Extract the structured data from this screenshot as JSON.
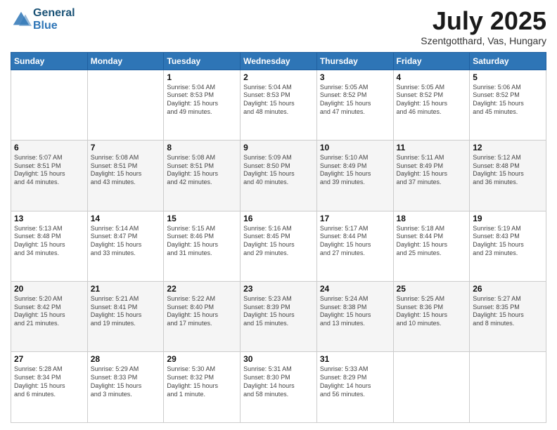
{
  "header": {
    "logo_line1": "General",
    "logo_line2": "Blue",
    "month": "July 2025",
    "location": "Szentgotthard, Vas, Hungary"
  },
  "weekdays": [
    "Sunday",
    "Monday",
    "Tuesday",
    "Wednesday",
    "Thursday",
    "Friday",
    "Saturday"
  ],
  "weeks": [
    [
      {
        "day": "",
        "text": ""
      },
      {
        "day": "",
        "text": ""
      },
      {
        "day": "1",
        "text": "Sunrise: 5:04 AM\nSunset: 8:53 PM\nDaylight: 15 hours\nand 49 minutes."
      },
      {
        "day": "2",
        "text": "Sunrise: 5:04 AM\nSunset: 8:53 PM\nDaylight: 15 hours\nand 48 minutes."
      },
      {
        "day": "3",
        "text": "Sunrise: 5:05 AM\nSunset: 8:52 PM\nDaylight: 15 hours\nand 47 minutes."
      },
      {
        "day": "4",
        "text": "Sunrise: 5:05 AM\nSunset: 8:52 PM\nDaylight: 15 hours\nand 46 minutes."
      },
      {
        "day": "5",
        "text": "Sunrise: 5:06 AM\nSunset: 8:52 PM\nDaylight: 15 hours\nand 45 minutes."
      }
    ],
    [
      {
        "day": "6",
        "text": "Sunrise: 5:07 AM\nSunset: 8:51 PM\nDaylight: 15 hours\nand 44 minutes."
      },
      {
        "day": "7",
        "text": "Sunrise: 5:08 AM\nSunset: 8:51 PM\nDaylight: 15 hours\nand 43 minutes."
      },
      {
        "day": "8",
        "text": "Sunrise: 5:08 AM\nSunset: 8:51 PM\nDaylight: 15 hours\nand 42 minutes."
      },
      {
        "day": "9",
        "text": "Sunrise: 5:09 AM\nSunset: 8:50 PM\nDaylight: 15 hours\nand 40 minutes."
      },
      {
        "day": "10",
        "text": "Sunrise: 5:10 AM\nSunset: 8:49 PM\nDaylight: 15 hours\nand 39 minutes."
      },
      {
        "day": "11",
        "text": "Sunrise: 5:11 AM\nSunset: 8:49 PM\nDaylight: 15 hours\nand 37 minutes."
      },
      {
        "day": "12",
        "text": "Sunrise: 5:12 AM\nSunset: 8:48 PM\nDaylight: 15 hours\nand 36 minutes."
      }
    ],
    [
      {
        "day": "13",
        "text": "Sunrise: 5:13 AM\nSunset: 8:48 PM\nDaylight: 15 hours\nand 34 minutes."
      },
      {
        "day": "14",
        "text": "Sunrise: 5:14 AM\nSunset: 8:47 PM\nDaylight: 15 hours\nand 33 minutes."
      },
      {
        "day": "15",
        "text": "Sunrise: 5:15 AM\nSunset: 8:46 PM\nDaylight: 15 hours\nand 31 minutes."
      },
      {
        "day": "16",
        "text": "Sunrise: 5:16 AM\nSunset: 8:45 PM\nDaylight: 15 hours\nand 29 minutes."
      },
      {
        "day": "17",
        "text": "Sunrise: 5:17 AM\nSunset: 8:44 PM\nDaylight: 15 hours\nand 27 minutes."
      },
      {
        "day": "18",
        "text": "Sunrise: 5:18 AM\nSunset: 8:44 PM\nDaylight: 15 hours\nand 25 minutes."
      },
      {
        "day": "19",
        "text": "Sunrise: 5:19 AM\nSunset: 8:43 PM\nDaylight: 15 hours\nand 23 minutes."
      }
    ],
    [
      {
        "day": "20",
        "text": "Sunrise: 5:20 AM\nSunset: 8:42 PM\nDaylight: 15 hours\nand 21 minutes."
      },
      {
        "day": "21",
        "text": "Sunrise: 5:21 AM\nSunset: 8:41 PM\nDaylight: 15 hours\nand 19 minutes."
      },
      {
        "day": "22",
        "text": "Sunrise: 5:22 AM\nSunset: 8:40 PM\nDaylight: 15 hours\nand 17 minutes."
      },
      {
        "day": "23",
        "text": "Sunrise: 5:23 AM\nSunset: 8:39 PM\nDaylight: 15 hours\nand 15 minutes."
      },
      {
        "day": "24",
        "text": "Sunrise: 5:24 AM\nSunset: 8:38 PM\nDaylight: 15 hours\nand 13 minutes."
      },
      {
        "day": "25",
        "text": "Sunrise: 5:25 AM\nSunset: 8:36 PM\nDaylight: 15 hours\nand 10 minutes."
      },
      {
        "day": "26",
        "text": "Sunrise: 5:27 AM\nSunset: 8:35 PM\nDaylight: 15 hours\nand 8 minutes."
      }
    ],
    [
      {
        "day": "27",
        "text": "Sunrise: 5:28 AM\nSunset: 8:34 PM\nDaylight: 15 hours\nand 6 minutes."
      },
      {
        "day": "28",
        "text": "Sunrise: 5:29 AM\nSunset: 8:33 PM\nDaylight: 15 hours\nand 3 minutes."
      },
      {
        "day": "29",
        "text": "Sunrise: 5:30 AM\nSunset: 8:32 PM\nDaylight: 15 hours\nand 1 minute."
      },
      {
        "day": "30",
        "text": "Sunrise: 5:31 AM\nSunset: 8:30 PM\nDaylight: 14 hours\nand 58 minutes."
      },
      {
        "day": "31",
        "text": "Sunrise: 5:33 AM\nSunset: 8:29 PM\nDaylight: 14 hours\nand 56 minutes."
      },
      {
        "day": "",
        "text": ""
      },
      {
        "day": "",
        "text": ""
      }
    ]
  ]
}
